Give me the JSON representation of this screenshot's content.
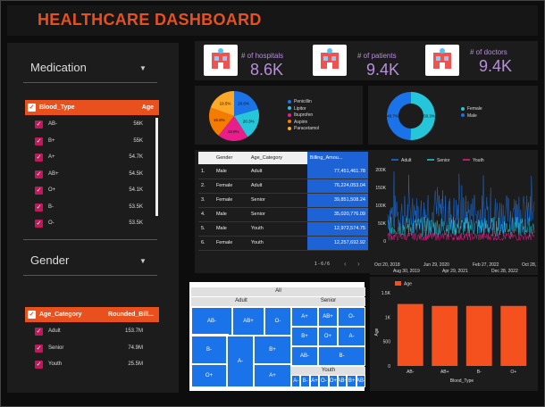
{
  "header": {
    "title": "HEALTHCARE DASHBOARD"
  },
  "colors": {
    "accent": "#e8501e",
    "kpi": "#b88fdc",
    "blue": "#1a73e8",
    "pink": "#e91e8c",
    "teal": "#26c6da"
  },
  "filters": {
    "medication_label": "Medication",
    "gender_label": "Gender",
    "blood_list": {
      "header_col1": "Blood_Type",
      "header_col2": "Age",
      "rows": [
        {
          "label": "AB-",
          "value": "56K"
        },
        {
          "label": "B+",
          "value": "55K"
        },
        {
          "label": "A+",
          "value": "54.7K"
        },
        {
          "label": "AB+",
          "value": "54.5K"
        },
        {
          "label": "O+",
          "value": "54.1K"
        },
        {
          "label": "B-",
          "value": "53.5K"
        },
        {
          "label": "O-",
          "value": "53.5K"
        }
      ]
    },
    "age_list": {
      "header_col1": "Age_Category",
      "header_col2": "Rounded_Bill...",
      "rows": [
        {
          "label": "Adult",
          "value": "153.7M"
        },
        {
          "label": "Senior",
          "value": "74.9M"
        },
        {
          "label": "Youth",
          "value": "25.5M"
        }
      ]
    }
  },
  "kpis": [
    {
      "label": "# of hospitals",
      "value": "8.6K",
      "icon": "hospital-icon"
    },
    {
      "label": "# of patients",
      "value": "9.4K",
      "icon": "patient-icon"
    },
    {
      "label": "# of doctors",
      "value": "9.4K",
      "icon": "doctor-icon"
    }
  ],
  "chart_data": [
    {
      "type": "pie",
      "title": "",
      "categories": [
        "Penicillin",
        "Lipitor",
        "Ibuprofen",
        "Aspirin",
        "Paracetamol"
      ],
      "values": [
        20.6,
        20.3,
        19.9,
        19.8,
        19.5
      ],
      "slice_labels": [
        "20.6%",
        "20.3%",
        "19.9%",
        "19.8%",
        "19.5%"
      ],
      "colors": [
        "#1a73e8",
        "#26c6da",
        "#e91e8c",
        "#f57c00",
        "#ffa726"
      ],
      "legend": "right"
    },
    {
      "type": "pie",
      "title": "",
      "categories": [
        "Female",
        "Male"
      ],
      "values": [
        50.3,
        49.7
      ],
      "slice_labels": [
        "50.3%",
        "49.7%"
      ],
      "colors": [
        "#26c6da",
        "#1a73e8"
      ],
      "donut": true,
      "legend": "right"
    },
    {
      "type": "table",
      "columns": [
        "",
        "Gender",
        "Age_Category",
        "Billing_Amou..."
      ],
      "rows": [
        [
          "1.",
          "Male",
          "Adult",
          "77,451,461.78"
        ],
        [
          "2.",
          "Female",
          "Adult",
          "76,224,053.04"
        ],
        [
          "3.",
          "Female",
          "Senior",
          "39,851,508.24"
        ],
        [
          "4.",
          "Male",
          "Senior",
          "35,020,776.09"
        ],
        [
          "5.",
          "Male",
          "Youth",
          "12,972,574.75"
        ],
        [
          "6.",
          "Female",
          "Youth",
          "12,257,692.92"
        ]
      ],
      "pagination": "1 - 6 / 6"
    },
    {
      "type": "line",
      "title": "",
      "series": [
        {
          "name": "Adult",
          "color": "#1a73e8"
        },
        {
          "name": "Senior",
          "color": "#26c6da"
        },
        {
          "name": "Youth",
          "color": "#e91e8c"
        }
      ],
      "yticks": [
        "200K",
        "150K",
        "100K",
        "50K",
        "0"
      ],
      "ylim": [
        0,
        200000
      ],
      "xticks_top": [
        "Oct 20, 2018",
        "Jun 29, 2020",
        "Feb 27, 2022",
        "Oct 28, 20..."
      ],
      "xticks_bottom": [
        "Aug 30, 2019",
        "Apr 29, 2021",
        "Dec 28, 2022"
      ],
      "legend": "top"
    },
    {
      "type": "heatmap",
      "subtype": "treemap",
      "root": "All",
      "groups": [
        {
          "name": "Adult",
          "cells": [
            "AB-",
            "AB+",
            "O-",
            "B-",
            "A-",
            "B+",
            "O+",
            "A+"
          ]
        },
        {
          "name": "Senior",
          "cells": [
            "A+",
            "AB+",
            "O-",
            "B+",
            "O+",
            "A-",
            "AB-",
            "B-"
          ]
        },
        {
          "name": "Youth",
          "cells": [
            "A-",
            "B-",
            "A+",
            "O-",
            "O+",
            "AB+",
            "B+",
            "AB-"
          ]
        }
      ]
    },
    {
      "type": "bar",
      "title": "",
      "categories": [
        "AB-",
        "AB+",
        "B-",
        "O+"
      ],
      "values": [
        1270,
        1230,
        1230,
        1230
      ],
      "series_name": "Age",
      "xlabel": "Blood_Type",
      "ylabel": "Age",
      "yticks": [
        "1.5K",
        "1K",
        "500",
        "0"
      ],
      "ylim": [
        0,
        1500
      ],
      "color": "#f4511e"
    }
  ]
}
